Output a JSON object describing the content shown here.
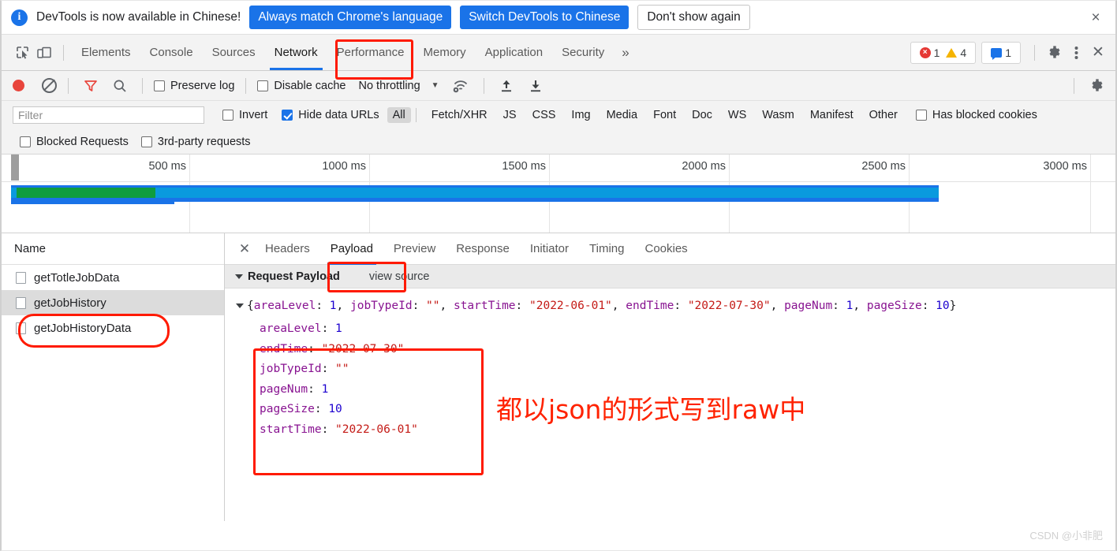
{
  "infobar": {
    "icon": "info-icon",
    "message": "DevTools is now available in Chinese!",
    "primary_button": "Always match Chrome's language",
    "secondary_button": "Switch DevTools to Chinese",
    "dismiss_button": "Don't show again",
    "close_icon": "×"
  },
  "tabstrip": {
    "inspect_icon": "inspect-element-icon",
    "device_icon": "device-toolbar-icon",
    "tabs": [
      {
        "label": "Elements",
        "active": false
      },
      {
        "label": "Console",
        "active": false
      },
      {
        "label": "Sources",
        "active": false
      },
      {
        "label": "Network",
        "active": true
      },
      {
        "label": "Performance",
        "active": false
      },
      {
        "label": "Memory",
        "active": false
      },
      {
        "label": "Application",
        "active": false
      },
      {
        "label": "Security",
        "active": false
      }
    ],
    "more_tabs": "»",
    "error_count": "1",
    "warning_count": "4",
    "message_count": "1",
    "settings_icon": "gear-icon",
    "menu_icon": "kebab-menu-icon",
    "close_icon": "✕"
  },
  "network_toolbar": {
    "record_label": "record-button",
    "clear_label": "clear-button",
    "filter_icon": "filter-funnel-icon",
    "search_icon": "search-icon",
    "preserve_log": {
      "label": "Preserve log",
      "checked": false
    },
    "disable_cache": {
      "label": "Disable cache",
      "checked": false
    },
    "throttling": "No throttling",
    "caret": "▼",
    "wifi_icon": "network-conditions-icon",
    "import_icon": "import-har-icon",
    "export_icon": "export-har-icon",
    "settings_icon": "network-settings-gear-icon"
  },
  "filter_bar": {
    "filter_value": "",
    "filter_placeholder": "Filter",
    "invert": {
      "label": "Invert",
      "checked": false
    },
    "hide_data_urls": {
      "label": "Hide data URLs",
      "checked": true
    },
    "types": [
      {
        "label": "All",
        "selected": true
      },
      {
        "label": "Fetch/XHR",
        "selected": false
      },
      {
        "label": "JS",
        "selected": false
      },
      {
        "label": "CSS",
        "selected": false
      },
      {
        "label": "Img",
        "selected": false
      },
      {
        "label": "Media",
        "selected": false
      },
      {
        "label": "Font",
        "selected": false
      },
      {
        "label": "Doc",
        "selected": false
      },
      {
        "label": "WS",
        "selected": false
      },
      {
        "label": "Wasm",
        "selected": false
      },
      {
        "label": "Manifest",
        "selected": false
      },
      {
        "label": "Other",
        "selected": false
      }
    ],
    "has_blocked_cookies": {
      "label": "Has blocked cookies",
      "checked": false
    },
    "blocked_requests": {
      "label": "Blocked Requests",
      "checked": false
    },
    "third_party_requests": {
      "label": "3rd-party requests",
      "checked": false
    }
  },
  "overview": {
    "ticks": [
      "500 ms",
      "1000 ms",
      "1500 ms",
      "2000 ms",
      "2500 ms",
      "3000 ms"
    ],
    "bar_colors": {
      "green": "#0f9d3f",
      "blue": "#0a9ade",
      "darkblue": "#1a73e8"
    }
  },
  "request_list": {
    "column_header": "Name",
    "rows": [
      {
        "name": "getTotleJobData",
        "selected": false
      },
      {
        "name": "getJobHistory",
        "selected": true
      },
      {
        "name": "getJobHistoryData",
        "selected": false
      }
    ]
  },
  "detail": {
    "close_icon": "✕",
    "tabs": [
      {
        "label": "Headers",
        "active": false
      },
      {
        "label": "Payload",
        "active": true
      },
      {
        "label": "Preview",
        "active": false
      },
      {
        "label": "Response",
        "active": false
      },
      {
        "label": "Initiator",
        "active": false
      },
      {
        "label": "Timing",
        "active": false
      },
      {
        "label": "Cookies",
        "active": false
      }
    ],
    "section_title": "Request Payload",
    "view_source": "view source",
    "summary_line": {
      "open_brace": "{",
      "close_brace": "}",
      "entries": [
        {
          "key": "areaLevel",
          "value": "1",
          "type": "num"
        },
        {
          "key": "jobTypeId",
          "value": "\"\"",
          "type": "str"
        },
        {
          "key": "startTime",
          "value": "\"2022-06-01\"",
          "type": "str"
        },
        {
          "key": "endTime",
          "value": "\"2022-07-30\"",
          "type": "str"
        },
        {
          "key": "pageNum",
          "value": "1",
          "type": "num"
        },
        {
          "key": "pageSize",
          "value": "10",
          "type": "num"
        }
      ]
    },
    "properties": [
      {
        "key": "areaLevel",
        "value": "1",
        "type": "num"
      },
      {
        "key": "endTime",
        "value": "\"2022-07-30\"",
        "type": "str"
      },
      {
        "key": "jobTypeId",
        "value": "\"\"",
        "type": "str"
      },
      {
        "key": "pageNum",
        "value": "1",
        "type": "num"
      },
      {
        "key": "pageSize",
        "value": "10",
        "type": "num"
      },
      {
        "key": "startTime",
        "value": "\"2022-06-01\"",
        "type": "str"
      }
    ]
  },
  "annotation": {
    "text": "都以json的形式写到raw中",
    "color": "#ff2200"
  },
  "watermark": "CSDN @小非肥"
}
